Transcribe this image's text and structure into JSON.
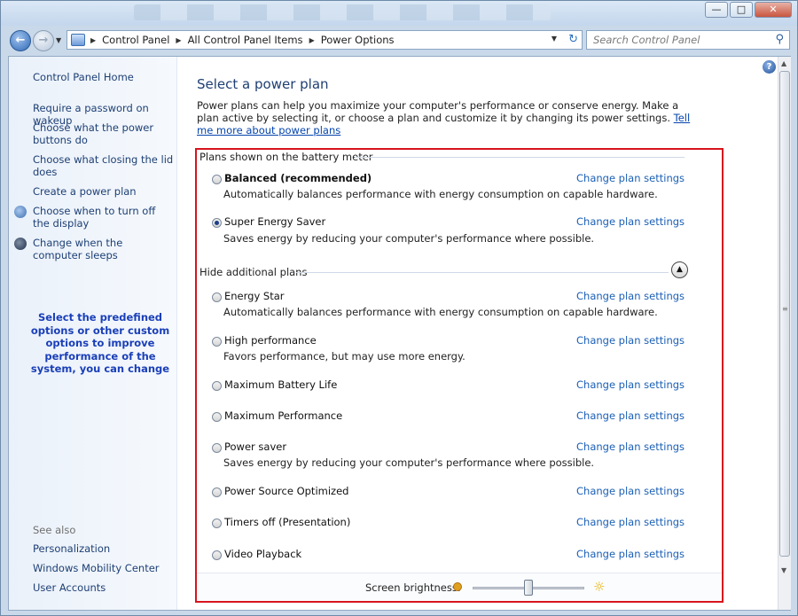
{
  "window": {
    "controls": {
      "minimize": "—",
      "maximize": "□",
      "close": "✕"
    }
  },
  "navigation": {
    "breadcrumbs": [
      "Control Panel",
      "All Control Panel Items",
      "Power Options"
    ],
    "search_placeholder": "Search Control Panel"
  },
  "sidebar": {
    "home": "Control Panel Home",
    "tasks": [
      "Require a password on wakeup",
      "Choose what the power buttons do",
      "Choose what closing the lid does",
      "Create a power plan",
      "Choose when to turn off the display",
      "Change when the computer sleeps"
    ],
    "note": "Select the predefined options or other custom options to improve performance of the system, you can change",
    "see_also_label": "See also",
    "see_also": [
      "Personalization",
      "Windows Mobility Center",
      "User Accounts"
    ]
  },
  "main": {
    "title": "Select a power plan",
    "intro": "Power plans can help you maximize your computer's performance or conserve energy. Make a plan active by selecting it, or choose a plan and customize it by changing its power settings.",
    "intro_link": "Tell me more about power plans",
    "battery_meter_heading": "Plans shown on the battery meter",
    "additional_heading": "Hide additional plans",
    "change_link": "Change plan settings",
    "plans": [
      {
        "name": "Balanced (recommended)",
        "desc": "Automatically balances performance with energy consumption on capable hardware.",
        "selected": false
      },
      {
        "name": "Super Energy Saver",
        "desc": "Saves energy by reducing your computer's performance where possible.",
        "selected": true
      },
      {
        "name": "Energy Star",
        "desc": "Automatically balances performance with energy consumption on capable hardware.",
        "selected": false
      },
      {
        "name": "High performance",
        "desc": "Favors performance, but may use more energy.",
        "selected": false
      },
      {
        "name": "Maximum Battery Life",
        "desc": "",
        "selected": false
      },
      {
        "name": "Maximum Performance",
        "desc": "",
        "selected": false
      },
      {
        "name": "Power saver",
        "desc": "Saves energy by reducing your computer's performance where possible.",
        "selected": false
      },
      {
        "name": "Power Source Optimized",
        "desc": "",
        "selected": false
      },
      {
        "name": "Timers off (Presentation)",
        "desc": "",
        "selected": false
      },
      {
        "name": "Video Playback",
        "desc": "",
        "selected": false
      }
    ],
    "brightness_label": "Screen brightness:",
    "brightness_level": 0.5
  }
}
